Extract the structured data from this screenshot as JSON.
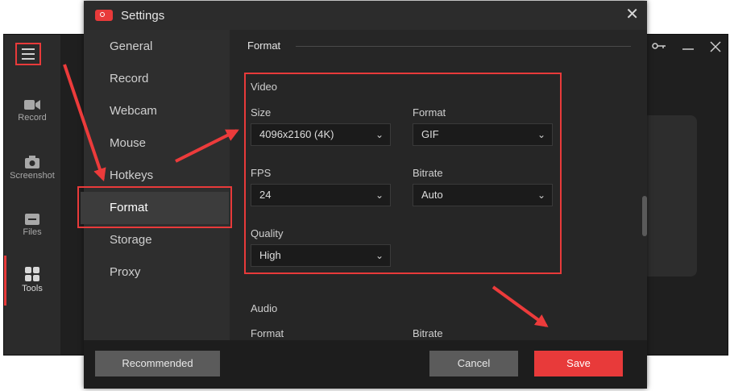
{
  "dialog": {
    "title": "Settings",
    "close_glyph": "✕",
    "nav": [
      {
        "label": "General"
      },
      {
        "label": "Record"
      },
      {
        "label": "Webcam"
      },
      {
        "label": "Mouse"
      },
      {
        "label": "Hotkeys"
      },
      {
        "label": "Format",
        "active": true
      },
      {
        "label": "Storage"
      },
      {
        "label": "Proxy"
      }
    ],
    "section_title": "Format",
    "video": {
      "heading": "Video",
      "size_label": "Size",
      "size_value": "4096x2160 (4K)",
      "format_label": "Format",
      "format_value": "GIF",
      "fps_label": "FPS",
      "fps_value": "24",
      "bitrate_label": "Bitrate",
      "bitrate_value": "Auto",
      "quality_label": "Quality",
      "quality_value": "High"
    },
    "audio": {
      "heading": "Audio",
      "format_label": "Format",
      "bitrate_label": "Bitrate"
    },
    "buttons": {
      "recommended": "Recommended",
      "cancel": "Cancel",
      "save": "Save"
    }
  },
  "background_app": {
    "rail": [
      {
        "label": "Record",
        "icon": "video-camera-icon"
      },
      {
        "label": "Screenshot",
        "icon": "camera-icon"
      },
      {
        "label": "Files",
        "icon": "folder-icon"
      },
      {
        "label": "Tools",
        "icon": "grid-icon"
      }
    ]
  },
  "colors": {
    "accent": "#e83a3a",
    "dialog_bg": "#252525",
    "nav_bg": "#2e2e2e"
  }
}
